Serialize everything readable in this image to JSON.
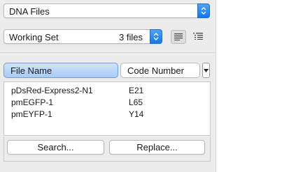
{
  "source_popup": {
    "label": "DNA Files"
  },
  "set_popup": {
    "label": "Working Set",
    "count": "3 files"
  },
  "view_buttons": {
    "list_icon": "lines-icon",
    "detail_icon": "bullet-list-icon"
  },
  "columns": [
    {
      "label": "File Name"
    },
    {
      "label": "Code Number"
    }
  ],
  "rows": [
    {
      "name": "pDsRed-Express2-N1",
      "code": "E21"
    },
    {
      "name": "pmEGFP-1",
      "code": "L65"
    },
    {
      "name": "pmEYFP-1",
      "code": "Y14"
    }
  ],
  "buttons": {
    "search": "Search...",
    "replace": "Replace..."
  },
  "colors": {
    "accent": "#1577e8",
    "header_selected": "#b9d6f8"
  }
}
